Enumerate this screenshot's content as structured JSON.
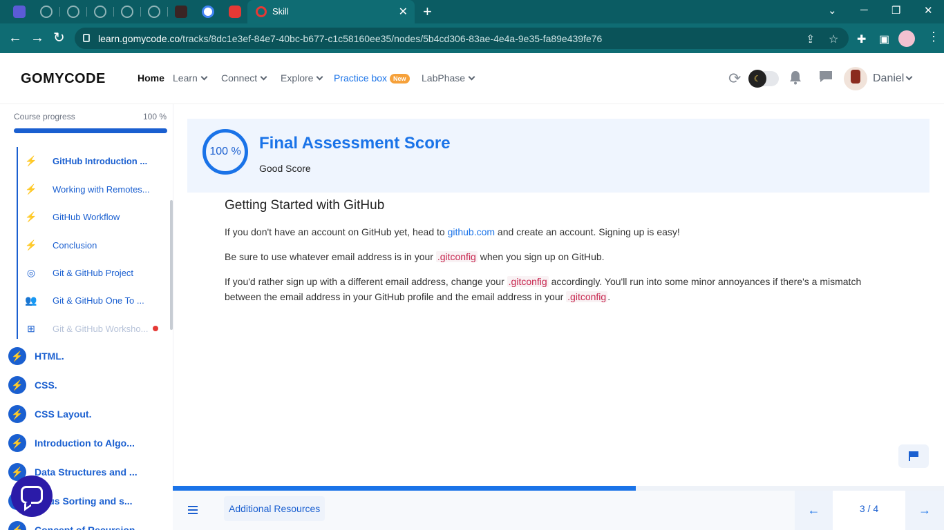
{
  "browser": {
    "active_tab_title": "Skill",
    "url_host": "learn.gomycode.co",
    "url_path": "/tracks/8dc1e3ef-84e7-40bc-b677-c1c58160ee35/nodes/5b4cd306-83ae-4e4a-9e35-fa89e439fe76"
  },
  "header": {
    "logo": "GOMYCODE",
    "nav": {
      "home": "Home",
      "learn": "Learn",
      "connect": "Connect",
      "explore": "Explore",
      "practice_box": "Practice box",
      "practice_badge": "New",
      "labphase": "LabPhase"
    },
    "user_name": "Daniel"
  },
  "sidebar": {
    "progress_label": "Course progress",
    "progress_text": "100 %",
    "progress_fraction": 1.0,
    "sub_items": [
      {
        "label": "GitHub Introduction ...",
        "icon": "bolt-icon",
        "state": "current"
      },
      {
        "label": "Working with Remotes...",
        "icon": "bolt-icon",
        "state": "done"
      },
      {
        "label": "GitHub Workflow",
        "icon": "bolt-icon",
        "state": "done"
      },
      {
        "label": "Conclusion",
        "icon": "bolt-icon",
        "state": "done"
      },
      {
        "label": "Git & GitHub Project",
        "icon": "target-icon",
        "state": "done"
      },
      {
        "label": "Git & GitHub One To ...",
        "icon": "people-icon",
        "state": "done"
      },
      {
        "label": "Git & GitHub Worksho...",
        "icon": "workshop-icon",
        "state": "locked"
      }
    ],
    "modules": [
      {
        "label": "HTML.",
        "icon": "bolt-icon"
      },
      {
        "label": "CSS.",
        "icon": "bolt-icon"
      },
      {
        "label": "CSS Layout.",
        "icon": "bolt-icon"
      },
      {
        "label": "Introduction to Algo...",
        "icon": "bolt-icon"
      },
      {
        "label": "Data Structures and ...",
        "icon": "bolt-icon"
      },
      {
        "label": "...ous Sorting and s...",
        "icon": "bolt-icon"
      },
      {
        "label": "Concept of Recursion...",
        "icon": "bolt-icon"
      }
    ]
  },
  "score": {
    "value_text": "100 %",
    "title": "Final Assessment Score",
    "subtitle": "Good Score"
  },
  "lesson": {
    "heading": "Getting Started with GitHub",
    "p1_a": "If you don't have an account on GitHub yet, head to ",
    "p1_link": "github.com",
    "p1_b": " and create an account. Signing up is easy!",
    "p2_a": "Be sure to use whatever email address is in your ",
    "p2_code": ".gitconfig",
    "p2_b": " when you sign up on GitHub.",
    "p3_a": "If you'd rather sign up with a different email address, change your ",
    "p3_code1": ".gitconfig",
    "p3_b": " accordingly. You'll run into some minor annoyances if there's a mismatch between the email address in your GitHub profile and the email address in your ",
    "p3_code2": ".gitconfig",
    "p3_c": "."
  },
  "bottom": {
    "resources_label": "Additional Resources",
    "page_indicator": "3 / 4",
    "progress_fraction": 0.6
  },
  "colors": {
    "brand_blue": "#1a73e8",
    "browser_teal": "#0f6c73",
    "accent_red": "#e53935"
  }
}
